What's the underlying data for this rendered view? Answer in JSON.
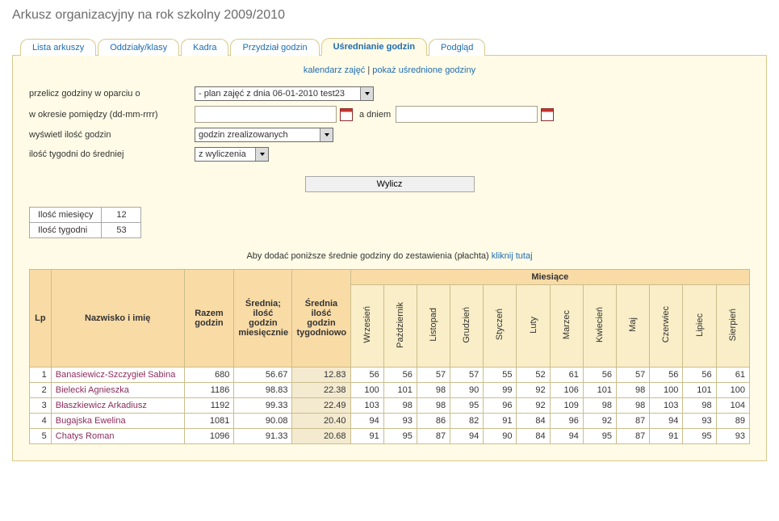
{
  "title": "Arkusz organizacyjny na rok szkolny 2009/2010",
  "tabs": [
    {
      "label": "Lista arkuszy"
    },
    {
      "label": "Oddziały/klasy"
    },
    {
      "label": "Kadra"
    },
    {
      "label": "Przydział godzin"
    },
    {
      "label": "Uśrednianie godzin"
    },
    {
      "label": "Podgląd"
    }
  ],
  "active_tab_index": 4,
  "top_links": {
    "a": "kalendarz zajęć",
    "b": "pokaż uśrednione godziny"
  },
  "form": {
    "label1": "przelicz godziny w oparciu o",
    "select1": "- plan zajęć z dnia 06-01-2010 test23",
    "label2": "w okresie pomiędzy (dd-mm-rrrr)",
    "date1": "",
    "between_label": "a dniem",
    "date2": "",
    "label3": "wyświetl ilość godzin",
    "select3": "godzin zrealizowanych",
    "label4": "ilość tygodni do średniej",
    "select4": "z wyliczenia",
    "button": "Wylicz"
  },
  "summary": {
    "row1_label": "Ilość miesięcy",
    "row1_value": "12",
    "row2_label": "Ilość tygodni",
    "row2_value": "53"
  },
  "caption_text": "Aby dodać poniższe średnie godziny do zestawienia (płachta) ",
  "caption_link": "kliknij tutaj",
  "headers": {
    "lp": "Lp",
    "name": "Nazwisko i imię",
    "sum": "Razem godzin",
    "avg_m": "Średnia; ilość godzin miesięcznie",
    "avg_w": "Średnia ilość godzin tygodniowo",
    "months_group": "Miesiące",
    "months": [
      "Wrzesień",
      "Październik",
      "Listopad",
      "Grudzień",
      "Styczeń",
      "Luty",
      "Marzec",
      "Kwiecień",
      "Maj",
      "Czerwiec",
      "Lipiec",
      "Sierpień"
    ]
  },
  "rows": [
    {
      "lp": 1,
      "name": "Banasiewicz-Szczygieł Sabina",
      "sum": 680,
      "avgm": "56.67",
      "avgw": "12.83",
      "m": [
        56,
        56,
        57,
        57,
        55,
        52,
        61,
        56,
        57,
        56,
        56,
        61
      ]
    },
    {
      "lp": 2,
      "name": "Bielecki Agnieszka",
      "sum": 1186,
      "avgm": "98.83",
      "avgw": "22.38",
      "m": [
        100,
        101,
        98,
        90,
        99,
        92,
        106,
        101,
        98,
        100,
        101,
        100
      ]
    },
    {
      "lp": 3,
      "name": "Błaszkiewicz Arkadiusz",
      "sum": 1192,
      "avgm": "99.33",
      "avgw": "22.49",
      "m": [
        103,
        98,
        98,
        95,
        96,
        92,
        109,
        98,
        98,
        103,
        98,
        104
      ]
    },
    {
      "lp": 4,
      "name": "Bugajska Ewelina",
      "sum": 1081,
      "avgm": "90.08",
      "avgw": "20.40",
      "m": [
        94,
        93,
        86,
        82,
        91,
        84,
        96,
        92,
        87,
        94,
        93,
        89
      ]
    },
    {
      "lp": 5,
      "name": "Chatys Roman",
      "sum": 1096,
      "avgm": "91.33",
      "avgw": "20.68",
      "m": [
        91,
        95,
        87,
        94,
        90,
        84,
        94,
        95,
        87,
        91,
        95,
        93
      ]
    }
  ]
}
